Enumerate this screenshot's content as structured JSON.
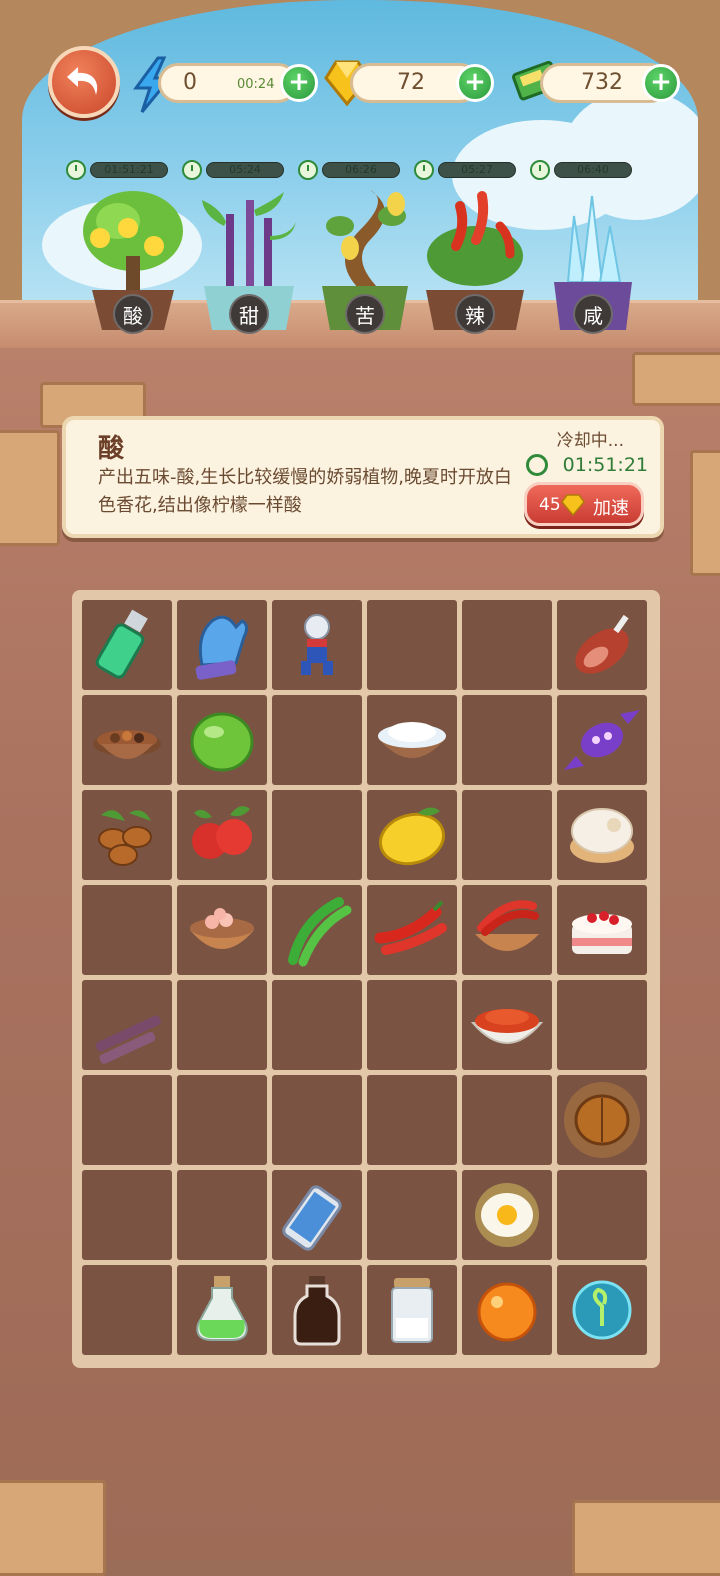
{
  "hud": {
    "energy": {
      "value": "0",
      "timer": "00:24"
    },
    "gems": {
      "value": "72"
    },
    "cash": {
      "value": "732"
    }
  },
  "plants": [
    {
      "label": "酸",
      "timer": "01:51:21",
      "progress": 0.0,
      "icon": "lemon-tree-icon"
    },
    {
      "label": "甜",
      "timer": "05:24",
      "progress": 0.0,
      "icon": "sugarcane-plant-icon"
    },
    {
      "label": "苦",
      "timer": "06:26",
      "progress": 0.0,
      "icon": "bitter-melon-plant-icon"
    },
    {
      "label": "辣",
      "timer": "05:27",
      "progress": 0.0,
      "icon": "chili-plant-icon"
    },
    {
      "label": "咸",
      "timer": "06:40",
      "progress": 0.0,
      "icon": "salt-crystal-plant-icon"
    }
  ],
  "info": {
    "title": "酸",
    "description": "产出五味-酸,生长比较缓慢的娇弱植物,晚夏时开放白色香花,结出像柠檬一样酸",
    "status": "冷却中...",
    "countdown": "01:51:21",
    "speedup_cost": "45",
    "speedup_label": "加速"
  },
  "grid": [
    [
      "lighter-icon",
      "oven-mitt-icon",
      "toy-figure-icon",
      "",
      "",
      "ham-leg-icon"
    ],
    [
      "spice-bowl-icon",
      "lime-icon",
      "",
      "salt-bowl-icon",
      "",
      "candy-icon"
    ],
    [
      "coffee-beans-icon",
      "hawthorn-icon",
      "",
      "lemon-icon",
      "",
      "cream-puff-icon"
    ],
    [
      "",
      "pink-salt-bowl-icon",
      "green-pepper-icon",
      "red-chili-icon",
      "chili-bowl-icon",
      "strawberry-cake-icon"
    ],
    [
      "sugarcane-icon",
      "",
      "",
      "",
      "chili-powder-icon",
      ""
    ],
    [
      "",
      "",
      "",
      "",
      "",
      "walnut-icon"
    ],
    [
      "",
      "",
      "smartphone-icon",
      "",
      "fried-egg-icon",
      ""
    ],
    [
      "",
      "green-potion-icon",
      "soy-sauce-bottle-icon",
      "salt-jar-icon",
      "orange-orb-icon",
      "sprout-orb-icon"
    ]
  ],
  "colors": {
    "accent_green": "#2b9a3a",
    "accent_red": "#c93c33",
    "panel": "#fbf2df"
  }
}
